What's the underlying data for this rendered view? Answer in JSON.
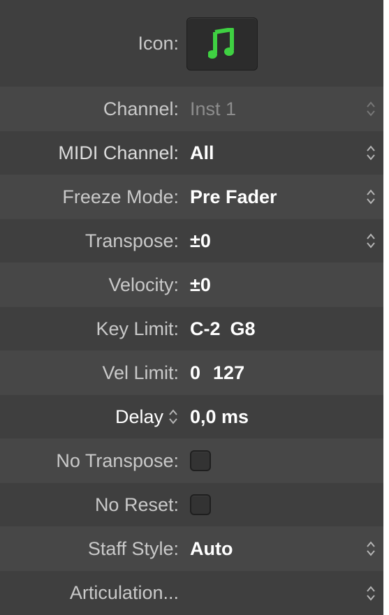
{
  "rows": [
    {
      "label": "Icon:",
      "type": "icon",
      "icon": "music-note-icon",
      "icon_color": "#3fd142"
    },
    {
      "label": "Channel:",
      "value": "Inst 1",
      "type": "select-dim"
    },
    {
      "label": "MIDI Channel:",
      "value": "All",
      "type": "select"
    },
    {
      "label": "Freeze Mode:",
      "value": "Pre Fader",
      "type": "select"
    },
    {
      "label": "Transpose:",
      "value": "±0",
      "type": "select"
    },
    {
      "label": "Velocity:",
      "value": "±0",
      "type": "value"
    },
    {
      "label": "Key Limit:",
      "value_low": "C-2",
      "value_high": "G8",
      "type": "range"
    },
    {
      "label": "Vel Limit:",
      "value_low": "0",
      "value_high": "127",
      "type": "range"
    },
    {
      "label": "Delay",
      "value": "0,0 ms",
      "type": "delay"
    },
    {
      "label": "No Transpose:",
      "type": "checkbox",
      "checked": false
    },
    {
      "label": "No Reset:",
      "type": "checkbox",
      "checked": false
    },
    {
      "label": "Staff Style:",
      "value": "Auto",
      "type": "select"
    },
    {
      "label": "Articulation...",
      "type": "select-empty"
    }
  ],
  "colors": {
    "panel_bg": "#3d3d3d",
    "label": "#c9c9c9",
    "value": "#ffffff",
    "dim_value": "#8d8d8d",
    "accent_green": "#3fd142"
  }
}
